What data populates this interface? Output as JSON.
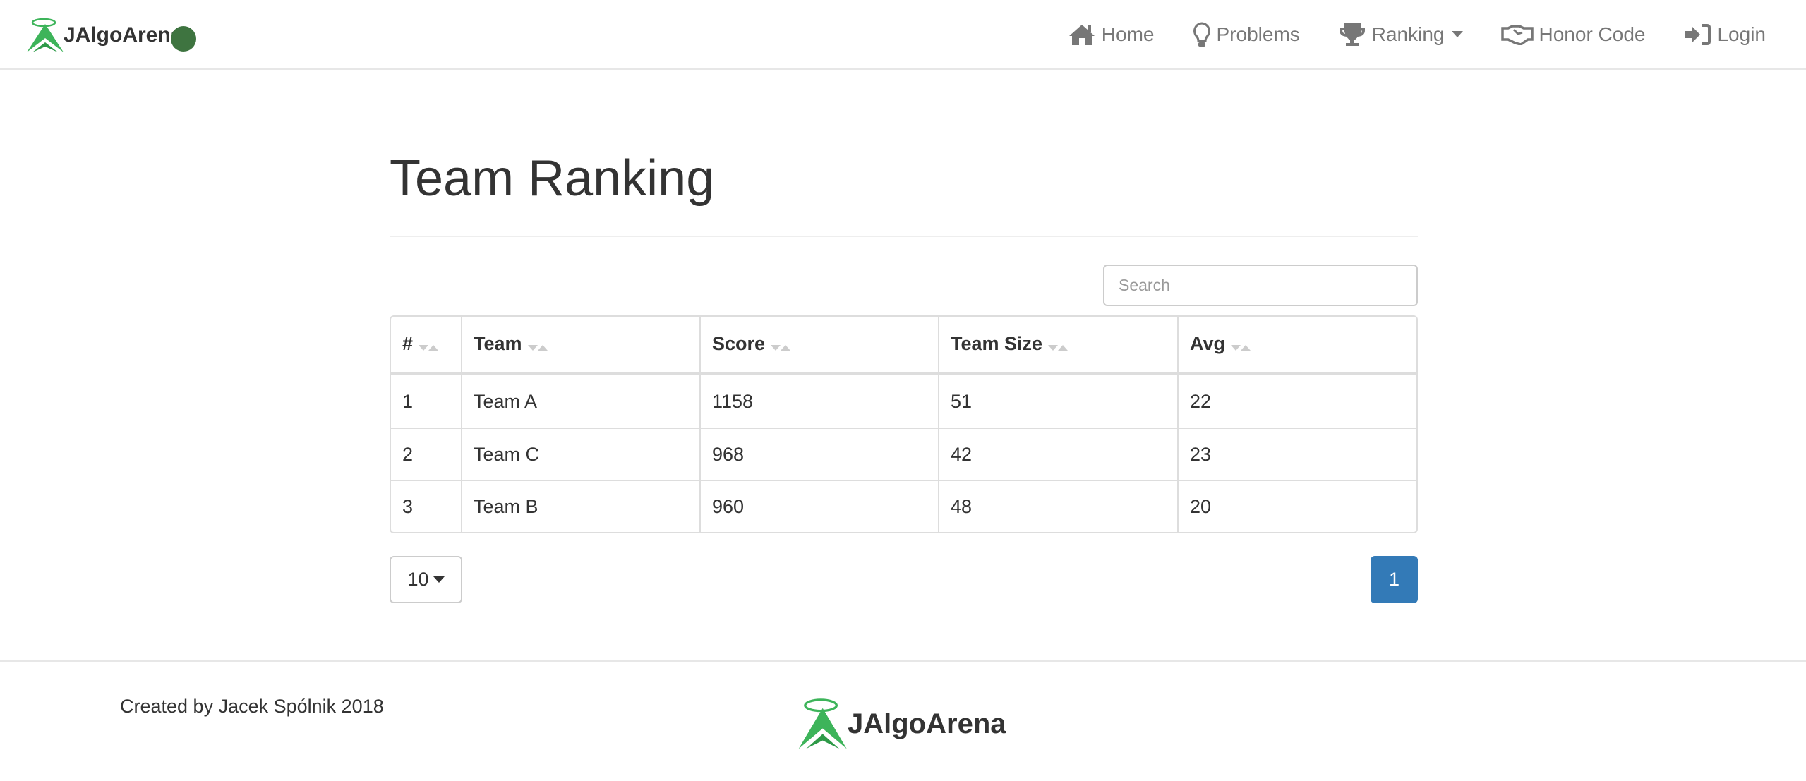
{
  "brand": {
    "name": "JAlgoArena",
    "status_color": "#3e7440"
  },
  "nav": {
    "items": [
      {
        "label": "Home",
        "icon": "home-icon"
      },
      {
        "label": "Problems",
        "icon": "lightbulb-icon"
      },
      {
        "label": "Ranking",
        "icon": "trophy-icon"
      },
      {
        "label": "Honor Code",
        "icon": "handshake-icon"
      },
      {
        "label": "Login",
        "icon": "sign-in-icon"
      }
    ]
  },
  "page": {
    "title": "Team Ranking"
  },
  "search": {
    "placeholder": "Search",
    "value": ""
  },
  "table": {
    "columns": [
      "#",
      "Team",
      "Score",
      "Team Size",
      "Avg"
    ],
    "rows": [
      [
        "1",
        "Team A",
        "1158",
        "51",
        "22"
      ],
      [
        "2",
        "Team C",
        "968",
        "42",
        "23"
      ],
      [
        "3",
        "Team B",
        "960",
        "48",
        "20"
      ]
    ]
  },
  "pagination": {
    "page_size": "10",
    "current_page": "1",
    "accent": "#337ab7"
  },
  "footer": {
    "credit": "Created by Jacek Spólnik 2018",
    "logo": "JAlgoArena"
  }
}
